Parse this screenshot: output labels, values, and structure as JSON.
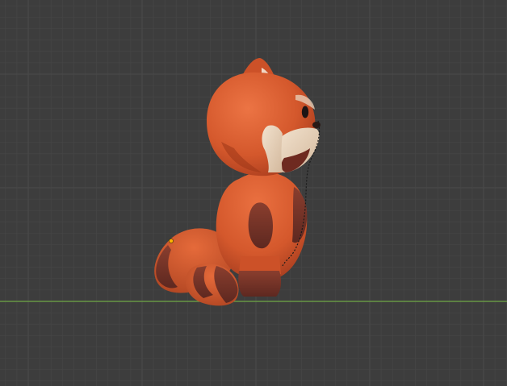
{
  "viewport": {
    "background_color": "#3d3d3d",
    "grid_minor_color": "#454545",
    "grid_major_color": "#4a4a4a",
    "ground_axis_color": "#6fa846"
  },
  "model": {
    "name": "",
    "body_color": "#d8562a",
    "dark_color": "#7a3528",
    "cream_color": "#e8d3bd",
    "eye_color": "#1e1414"
  },
  "selection": {
    "vertex_marker_color": "#ffb300",
    "edge_color": "#1a1a1a"
  }
}
